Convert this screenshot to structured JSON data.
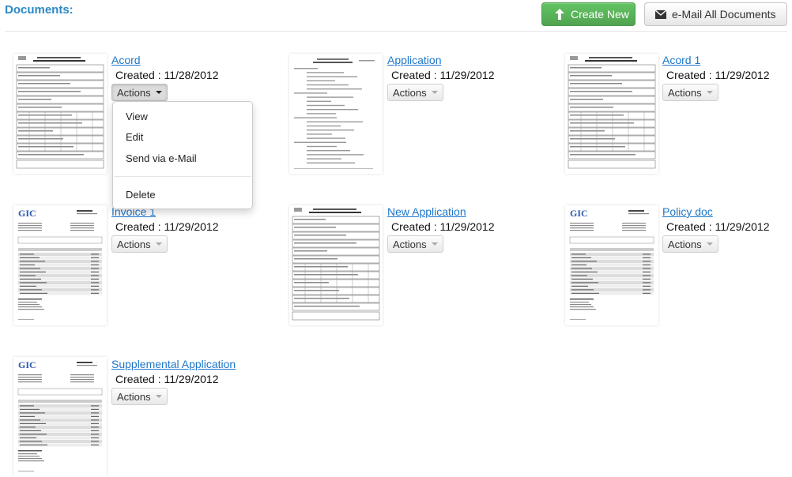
{
  "header": {
    "title": "Documents:",
    "create_label": "Create New",
    "email_all_label": "e-Mail All Documents"
  },
  "documents": [
    {
      "title": "Acord",
      "created": "Created : 11/28/2012",
      "actions_label": "Actions",
      "thumb": "form"
    },
    {
      "title": "Application",
      "created": "Created : 11/29/2012",
      "actions_label": "Actions",
      "thumb": "letter"
    },
    {
      "title": "Acord 1",
      "created": "Created : 11/29/2012",
      "actions_label": "Actions",
      "thumb": "form"
    },
    {
      "title": "Invoice 1",
      "created": "Created : 11/29/2012",
      "actions_label": "Actions",
      "thumb": "invoice"
    },
    {
      "title": "New Application",
      "created": "Created : 11/29/2012",
      "actions_label": "Actions",
      "thumb": "form"
    },
    {
      "title": "Policy doc",
      "created": "Created : 11/29/2012",
      "actions_label": "Actions",
      "thumb": "invoice"
    },
    {
      "title": "Supplemental Application",
      "created": "Created : 11/29/2012",
      "actions_label": "Actions",
      "thumb": "invoice"
    }
  ],
  "actions_menu": {
    "items": [
      "View",
      "Edit",
      "Send via e-Mail"
    ],
    "delete_label": "Delete"
  },
  "thumb_logo": "GIC",
  "colors": {
    "brand": "#2a8ac6",
    "create": "#5bb75b",
    "link": "#1f77c9"
  }
}
